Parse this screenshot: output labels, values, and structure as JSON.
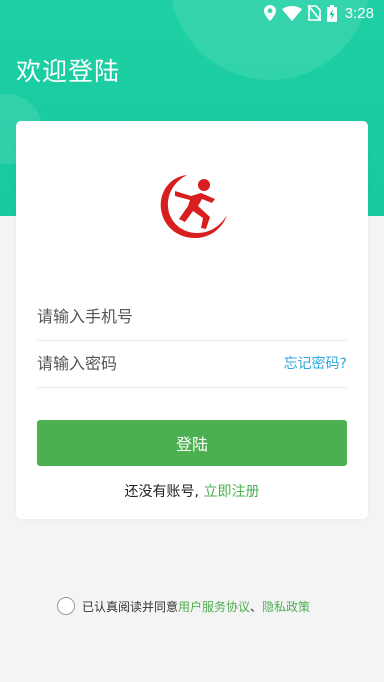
{
  "status_bar": {
    "time": "3:28",
    "icons": [
      "location-icon",
      "wifi-icon",
      "no-sim-icon",
      "battery-charging-icon"
    ]
  },
  "header": {
    "title": "欢迎登陆"
  },
  "logo": {
    "icon": "running-person-logo",
    "color": "#d81e1e"
  },
  "form": {
    "phone_placeholder": "请输入手机号",
    "password_placeholder": "请输入密码",
    "forgot_password": "忘记密码?",
    "login_button": "登陆",
    "no_account_text": "还没有账号,",
    "register_link": "立即注册"
  },
  "agreement": {
    "checked": false,
    "prefix": "已认真阅读并同意",
    "user_agreement": "用户服务协议",
    "separator": "、",
    "privacy_policy": "隐私政策"
  },
  "colors": {
    "header": "#1ed0a4",
    "primary_button": "#4caf50",
    "link_blue": "#2ea8e0",
    "link_green": "#4caf50",
    "logo_red": "#d81e1e"
  }
}
